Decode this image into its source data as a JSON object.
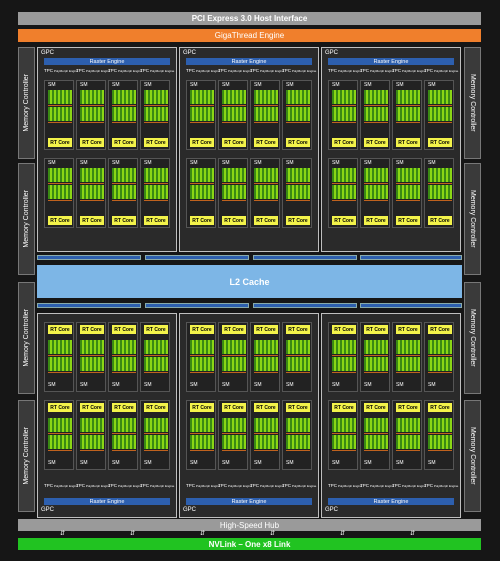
{
  "diagram": {
    "pcie": "PCI Express 3.0 Host Interface",
    "gigathread": "GigaThread Engine",
    "l2_cache": "L2 Cache",
    "high_speed_hub": "High-Speed Hub",
    "nvlink": "NVLink – One x8 Link",
    "memory_controller": "Memory Controller",
    "gpc_label": "GPC",
    "raster_engine": "Raster Engine",
    "tpc_label": "TPC",
    "polymorph": "PolyMorph Engine",
    "sm_label": "SM",
    "rt_core": "RT Core"
  },
  "colors": {
    "background": "#161616",
    "pcie_bar": "#9a9a9a",
    "gigathread_bar": "#f07f2c",
    "l2_cache": "#7db6e6",
    "nvlink_bar": "#21c321",
    "raster_engine": "#2d5fae",
    "rt_core": "#f3f34a",
    "cuda_core_dark": "#3a8a13",
    "cuda_core_light": "#8ad615",
    "texture_unit": "#c0621e"
  },
  "counts": {
    "gpcs": 6,
    "memory_controllers": 8,
    "tpcs_per_gpc": 4,
    "sms_per_gpc": 8
  }
}
